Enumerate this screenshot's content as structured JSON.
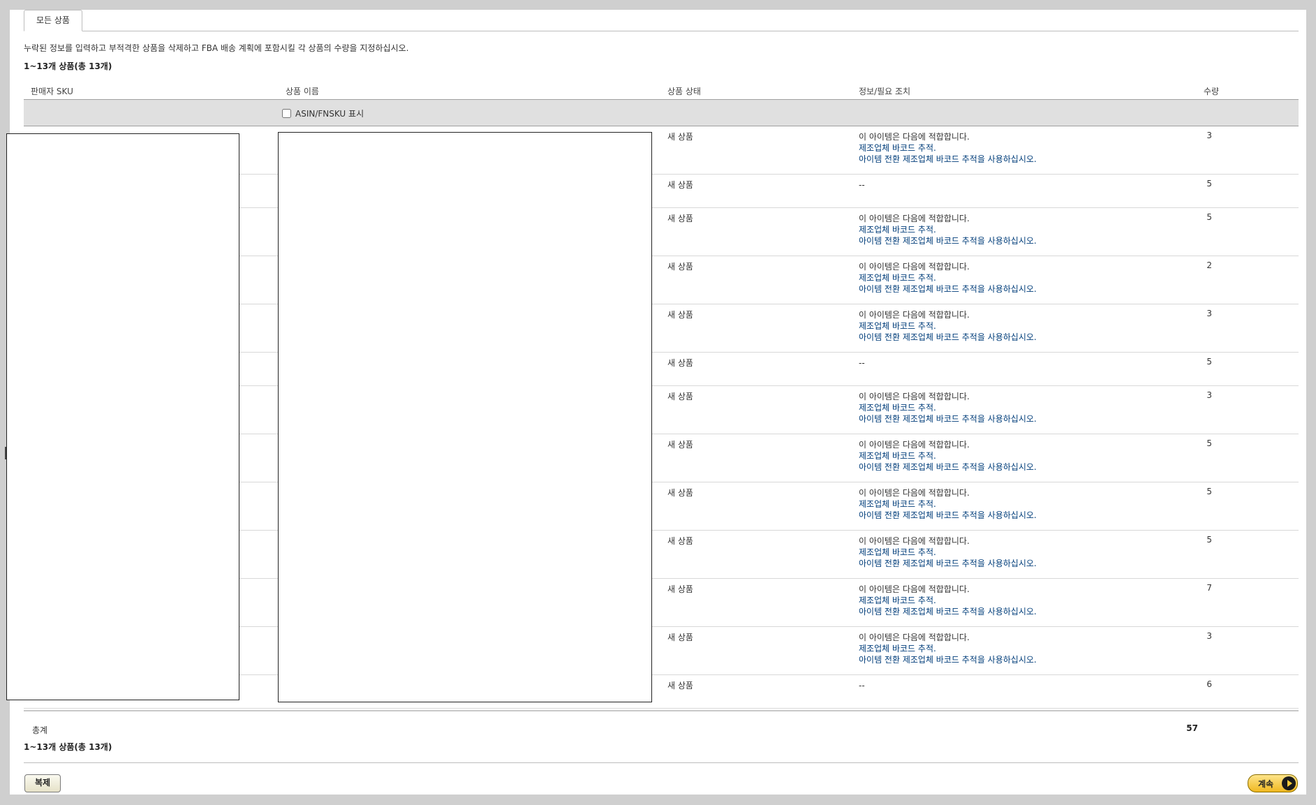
{
  "tab": {
    "label": "모든 상품"
  },
  "instructions": "누락된 정보를 입력하고 부적격한 상품을 삭제하고 FBA 배송 계획에 포함시킬 각 상품의 수량을 지정하십시오.",
  "count_text": "1~13개 상품(총 13개)",
  "columns": {
    "sku": "판매자 SKU",
    "name": "상품 이름",
    "condition": "상품 상태",
    "info": "정보/필요 조치",
    "quantity": "수량"
  },
  "filter": {
    "show_asin_label": "ASIN/FNSKU 표시",
    "checked": false
  },
  "rows": [
    {
      "condition": "새 상품",
      "info1": "이 아이템은 다음에 적합합니다.",
      "info2": "제조업체 바코드 추적.",
      "info3": "아이템 전환 제조업체 바코드 추적을 사용하십시오.",
      "qty": "3"
    },
    {
      "condition": "새 상품",
      "info1": "--",
      "info2": "",
      "info3": "",
      "qty": "5"
    },
    {
      "condition": "새 상품",
      "info1": "이 아이템은 다음에 적합합니다.",
      "info2": "제조업체 바코드 추적.",
      "info3": "아이템 전환 제조업체 바코드 추적을 사용하십시오.",
      "qty": "5"
    },
    {
      "condition": "새 상품",
      "info1": "이 아이템은 다음에 적합합니다.",
      "info2": "제조업체 바코드 추적.",
      "info3": "아이템 전환 제조업체 바코드 추적을 사용하십시오.",
      "qty": "2"
    },
    {
      "condition": "새 상품",
      "info1": "이 아이템은 다음에 적합합니다.",
      "info2": "제조업체 바코드 추적.",
      "info3": "아이템 전환 제조업체 바코드 추적을 사용하십시오.",
      "qty": "3"
    },
    {
      "condition": "새 상품",
      "info1": "--",
      "info2": "",
      "info3": "",
      "qty": "5"
    },
    {
      "condition": "새 상품",
      "info1": "이 아이템은 다음에 적합합니다.",
      "info2": "제조업체 바코드 추적.",
      "info3": "아이템 전환 제조업체 바코드 추적을 사용하십시오.",
      "qty": "3"
    },
    {
      "condition": "새 상품",
      "info1": "이 아이템은 다음에 적합합니다.",
      "info2": "제조업체 바코드 추적.",
      "info3": "아이템 전환 제조업체 바코드 추적을 사용하십시오.",
      "qty": "5"
    },
    {
      "condition": "새 상품",
      "info1": "이 아이템은 다음에 적합합니다.",
      "info2": "제조업체 바코드 추적.",
      "info3": "아이템 전환 제조업체 바코드 추적을 사용하십시오.",
      "qty": "5"
    },
    {
      "condition": "새 상품",
      "info1": "이 아이템은 다음에 적합합니다.",
      "info2": "제조업체 바코드 추적.",
      "info3": "아이템 전환 제조업체 바코드 추적을 사용하십시오.",
      "qty": "5"
    },
    {
      "condition": "새 상품",
      "info1": "이 아이템은 다음에 적합합니다.",
      "info2": "제조업체 바코드 추적.",
      "info3": "아이템 전환 제조업체 바코드 추적을 사용하십시오.",
      "qty": "7"
    },
    {
      "condition": "새 상품",
      "info1": "이 아이템은 다음에 적합합니다.",
      "info2": "제조업체 바코드 추적.",
      "info3": "아이템 전환 제조업체 바코드 추적을 사용하십시오.",
      "qty": "3"
    },
    {
      "condition": "새 상품",
      "info1": "--",
      "info2": "",
      "info3": "",
      "qty": "6"
    }
  ],
  "total": {
    "label": "총계",
    "value": "57"
  },
  "buttons": {
    "duplicate": "복제",
    "continue": "계속"
  },
  "colors": {
    "link": "#003d7a",
    "continue_button": "#f0b820",
    "header_band": "#e0e0e0"
  }
}
